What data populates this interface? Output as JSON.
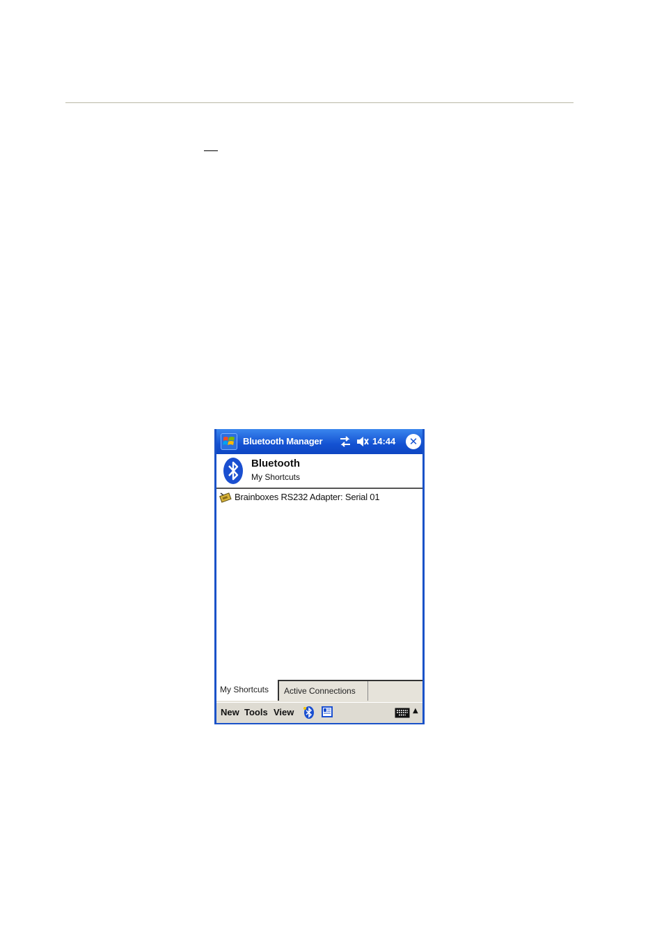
{
  "title_bar": {
    "app_title": "Bluetooth Manager",
    "clock": "14:44",
    "close_glyph": "✕",
    "colors": {
      "bar": "#1452d2",
      "text": "#ffffff"
    }
  },
  "header": {
    "title": "Bluetooth",
    "subtitle": "My Shortcuts"
  },
  "list": {
    "items": [
      {
        "label": "Brainboxes RS232 Adapter: Serial 01",
        "icon": "serial-adapter-icon"
      }
    ]
  },
  "tabs": [
    {
      "label": "My Shortcuts",
      "active": true
    },
    {
      "label": "Active Connections",
      "active": false
    }
  ],
  "command_bar": {
    "menus": [
      "New",
      "Tools",
      "View"
    ],
    "arrow": "▲"
  }
}
